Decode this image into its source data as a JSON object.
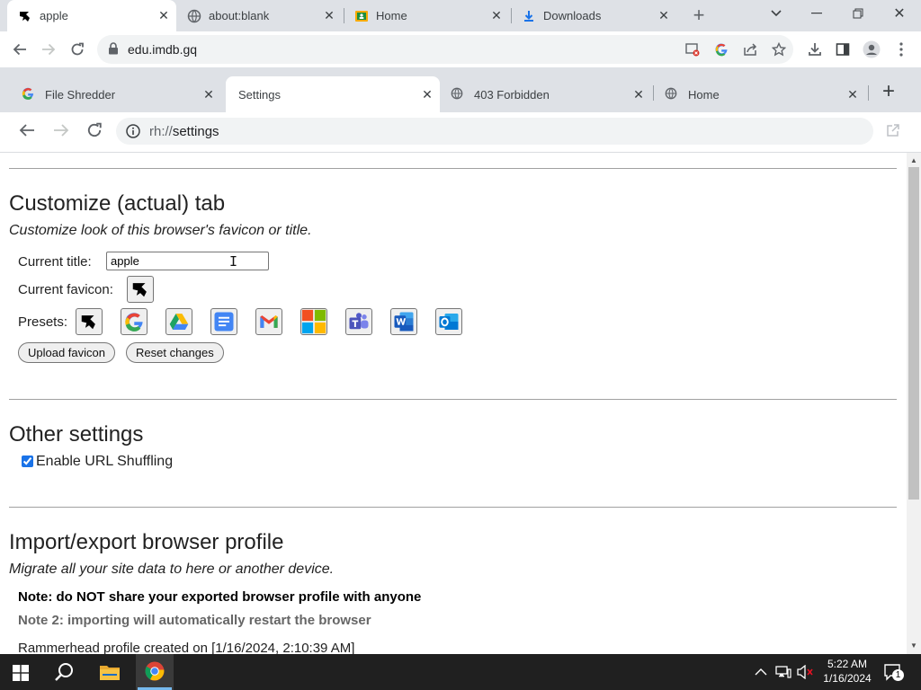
{
  "outer": {
    "tabs": [
      {
        "label": "apple",
        "active": true
      },
      {
        "label": "about:blank",
        "active": false
      },
      {
        "label": "Home",
        "active": false
      },
      {
        "label": "Downloads",
        "active": false
      }
    ],
    "url": "edu.imdb.gq"
  },
  "inner": {
    "tabs": [
      {
        "label": "File Shredder"
      },
      {
        "label": "Settings"
      },
      {
        "label": "403 Forbidden"
      },
      {
        "label": "Home"
      }
    ],
    "url": "rh://settings"
  },
  "customize": {
    "heading": "Customize (actual) tab",
    "description": "Customize look of this browser's favicon or title.",
    "title_label": "Current title:",
    "title_value": "apple",
    "favicon_label": "Current favicon:",
    "presets_label": "Presets:",
    "presets": [
      "rammerhead-icon",
      "google-icon",
      "google-drive-icon",
      "google-docs-icon",
      "gmail-icon",
      "microsoft-icon",
      "teams-icon",
      "word-icon",
      "outlook-icon"
    ],
    "upload_label": "Upload favicon",
    "reset_label": "Reset changes"
  },
  "other": {
    "heading": "Other settings",
    "url_shuffling_label": "Enable URL Shuffling",
    "url_shuffling_checked": true
  },
  "import_export": {
    "heading": "Import/export browser profile",
    "description": "Migrate all your site data to here or another device.",
    "note1": "Note: do NOT share your exported browser profile with anyone",
    "note2": "Note 2: importing will automatically restart the browser",
    "profile_created": "Rammerhead profile created on [1/16/2024, 2:10:39 AM]"
  },
  "taskbar": {
    "time": "5:22 AM",
    "date": "1/16/2024",
    "notification_count": "1"
  },
  "colors": {
    "accent": "#1a73e8",
    "taskbar": "#202020",
    "tabstrip": "#dee1e6"
  }
}
